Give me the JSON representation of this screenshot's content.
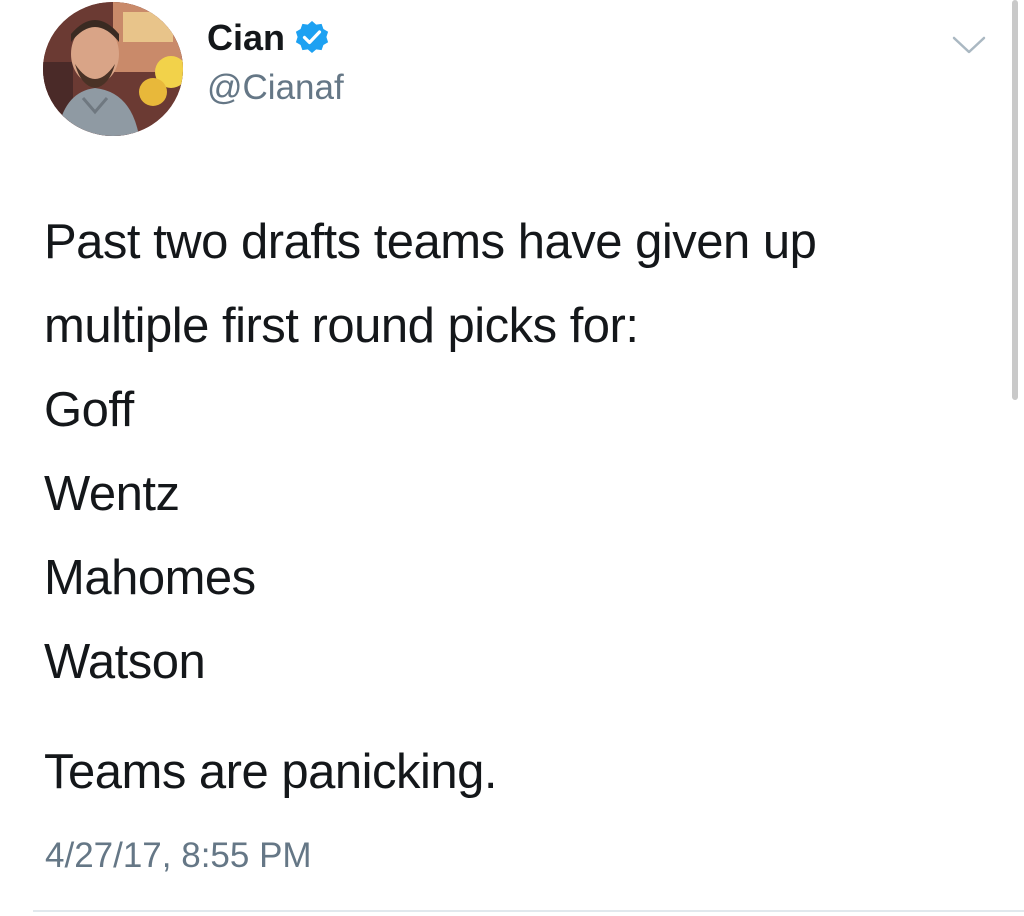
{
  "tweet": {
    "author": {
      "display_name": "Cian",
      "handle": "@Cianaf",
      "verified": true
    },
    "lines": [
      "Past two drafts teams have given up",
      "multiple first round picks for:",
      "Goff",
      "Wentz",
      "Mahomes",
      "Watson"
    ],
    "closing_line": "Teams are panicking.",
    "timestamp": "4/27/17, 8:55 PM"
  },
  "icons": {
    "verified": "verified-badge-icon",
    "menu": "chevron-down-icon"
  },
  "colors": {
    "text_primary": "#14171a",
    "text_secondary": "#657786",
    "verified_blue": "#1da1f2",
    "divider": "#e1e8ed"
  }
}
